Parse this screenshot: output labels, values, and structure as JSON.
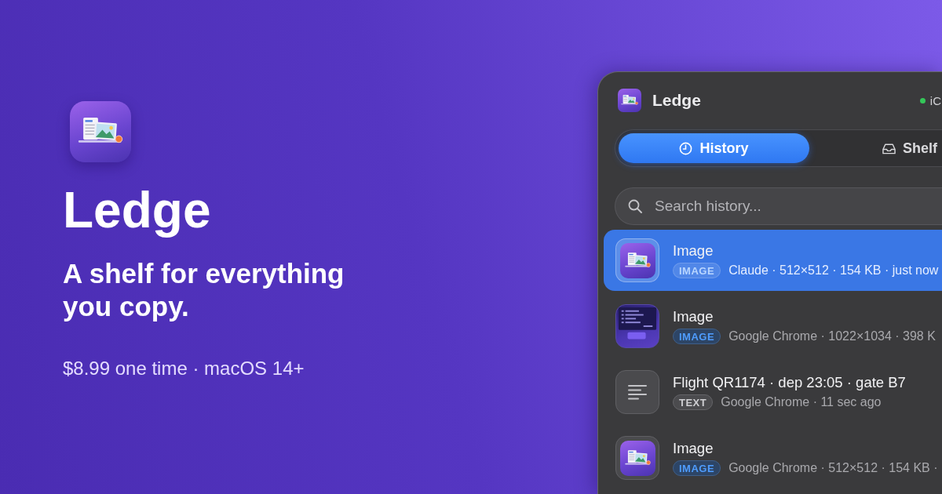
{
  "hero": {
    "app_name": "Ledge",
    "tagline": "A shelf for everything you copy.",
    "price_line": "$8.99 one time · macOS 14+"
  },
  "window": {
    "title": "Ledge",
    "sync": {
      "label": "iC",
      "online": true
    }
  },
  "tabs": [
    {
      "kind": "history",
      "label": "History",
      "selected": true
    },
    {
      "kind": "shelf",
      "label": "Shelf",
      "selected": false
    }
  ],
  "search": {
    "placeholder": "Search history..."
  },
  "items": [
    {
      "kind": "icon",
      "title": "Image",
      "badge": "IMAGE",
      "meta": "Claude · 512×512 · 154 KB · just now",
      "selected": true
    },
    {
      "kind": "screenshot",
      "title": "Image",
      "badge": "IMAGE",
      "meta": "Google Chrome · 1022×1034 · 398 K",
      "selected": false
    },
    {
      "kind": "text",
      "title": "Flight QR1174 · dep 23:05 · gate B7",
      "badge": "TEXT",
      "meta": "Google Chrome · 11 sec ago",
      "selected": false
    },
    {
      "kind": "icon",
      "title": "Image",
      "badge": "IMAGE",
      "meta": "Google Chrome · 512×512 · 154 KB ·",
      "selected": false
    }
  ]
}
